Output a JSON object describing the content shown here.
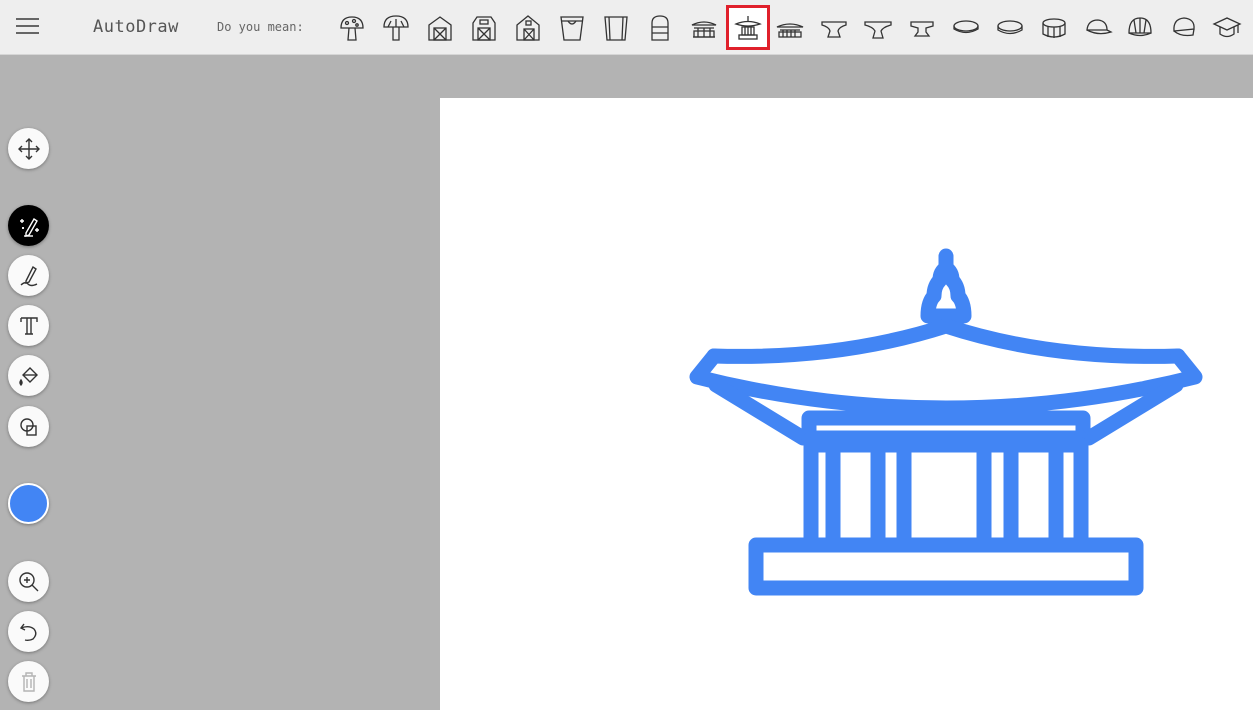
{
  "app": {
    "title": "AutoDraw",
    "prompt": "Do you mean:"
  },
  "suggestions": [
    {
      "name": "mushroom-spotted"
    },
    {
      "name": "mushroom"
    },
    {
      "name": "barn"
    },
    {
      "name": "barn-wide"
    },
    {
      "name": "barn-side"
    },
    {
      "name": "bucket"
    },
    {
      "name": "bucket-wide"
    },
    {
      "name": "jar"
    },
    {
      "name": "pagoda-small"
    },
    {
      "name": "pagoda",
      "selected": true
    },
    {
      "name": "temple"
    },
    {
      "name": "anvil"
    },
    {
      "name": "anvil-2"
    },
    {
      "name": "anvil-3"
    },
    {
      "name": "coin"
    },
    {
      "name": "coin-2"
    },
    {
      "name": "drum"
    },
    {
      "name": "cap"
    },
    {
      "name": "baseball-cap"
    },
    {
      "name": "hat"
    },
    {
      "name": "graduation-cap"
    }
  ],
  "tools": [
    {
      "name": "move-tool",
      "icon": "move-icon"
    },
    {
      "name": "autodraw-tool",
      "icon": "autodraw-icon",
      "active": true
    },
    {
      "name": "draw-tool",
      "icon": "pencil-icon"
    },
    {
      "name": "type-tool",
      "icon": "text-icon"
    },
    {
      "name": "fill-tool",
      "icon": "fill-icon"
    },
    {
      "name": "shape-tool",
      "icon": "shape-icon"
    },
    {
      "name": "zoom-tool",
      "icon": "zoom-icon"
    },
    {
      "name": "undo-tool",
      "icon": "undo-icon"
    },
    {
      "name": "delete-tool",
      "icon": "trash-icon",
      "disabled": true
    }
  ],
  "colors": {
    "selected": "#4285f4",
    "selection_border": "#e0202b",
    "toolbar_bg": "#eeeeee",
    "workspace_bg": "#b3b3b3"
  }
}
